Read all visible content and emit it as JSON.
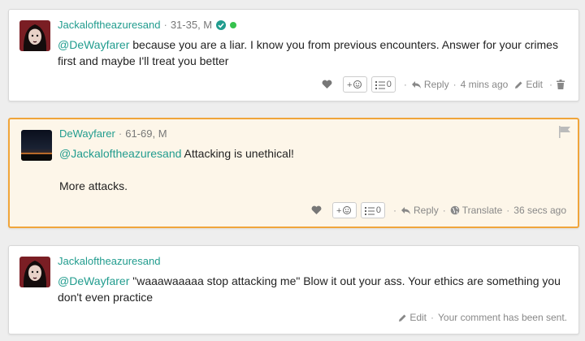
{
  "comments": [
    {
      "username": "Jackaloftheazuresand",
      "meta": "31-35, M",
      "mention": "@DeWayfarer",
      "text_line1": " because you are a liar. I know you from previous encounters. Answer for your crimes",
      "text_line2": "first and maybe I'll treat you better",
      "reaction_count": "0",
      "reply_label": "Reply",
      "time": "4 mins ago",
      "edit_label": "Edit"
    },
    {
      "username": "DeWayfarer",
      "meta": "61-69, M",
      "mention": "@Jackaloftheazuresand",
      "text_line1": " Attacking is unethical!",
      "text_line2": "More attacks.",
      "reaction_count": "0",
      "reply_label": "Reply",
      "translate_label": "Translate",
      "time": "36 secs ago"
    },
    {
      "username": "Jackaloftheazuresand",
      "mention": "@DeWayfarer",
      "text_line1": " \"waaawaaaaa stop attacking me\" Blow it out your ass. Your ethics are something you",
      "text_line2": "don't even practice",
      "edit_label": "Edit",
      "status": "Your comment has been sent."
    }
  ],
  "colors": {
    "accent": "#219c8e",
    "highlight_border": "#f0a53b",
    "highlight_bg": "#fdf6e9",
    "online": "#36c24d"
  },
  "icons": [
    "verified-icon",
    "online-dot-icon",
    "heart-icon",
    "add-reaction-icon",
    "list-icon",
    "reply-icon",
    "edit-icon",
    "trash-icon",
    "globe-icon",
    "flag-icon"
  ]
}
